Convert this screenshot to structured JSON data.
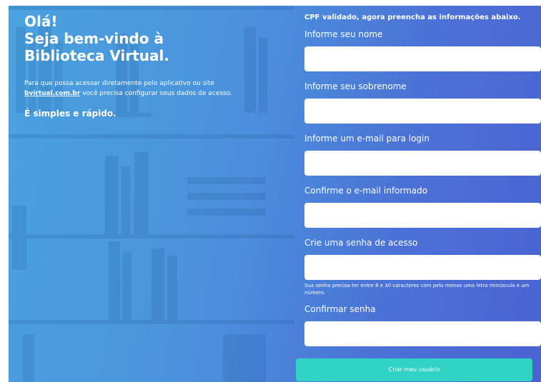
{
  "welcome": {
    "greeting_line1": "Olá!",
    "greeting_line2": "Seja bem-vindo à",
    "greeting_line3": "Biblioteca Virtual.",
    "intro_before": "Para que possa acessar diretamente pelo aplicativo ou site ",
    "intro_link": "bvirtual.com.br",
    "intro_after": " você precisa configurar seus dados de acesso.",
    "tagline": "É simples e rápido."
  },
  "form": {
    "status": "CPF validado, agora preencha as informações abaixo.",
    "fields": [
      {
        "label": "Informe seu nome",
        "value": ""
      },
      {
        "label": "Informe seu sobrenome",
        "value": ""
      },
      {
        "label": "Informe um e-mail para login",
        "value": ""
      },
      {
        "label": "Confirme o e-mail informado",
        "value": ""
      },
      {
        "label": "Crie uma senha de acesso",
        "value": ""
      },
      {
        "label": "Confirmar senha",
        "value": ""
      }
    ],
    "password_hint": "Sua senha precisa ter entre 8 e 30 caracteres com pelo menos uma letra minúscula e um número.",
    "submit_label": "Criar meu usuário"
  },
  "colors": {
    "submit_button": "#32d3c7",
    "panel_left": "#4aa3df",
    "panel_right": "#4a63d1"
  }
}
